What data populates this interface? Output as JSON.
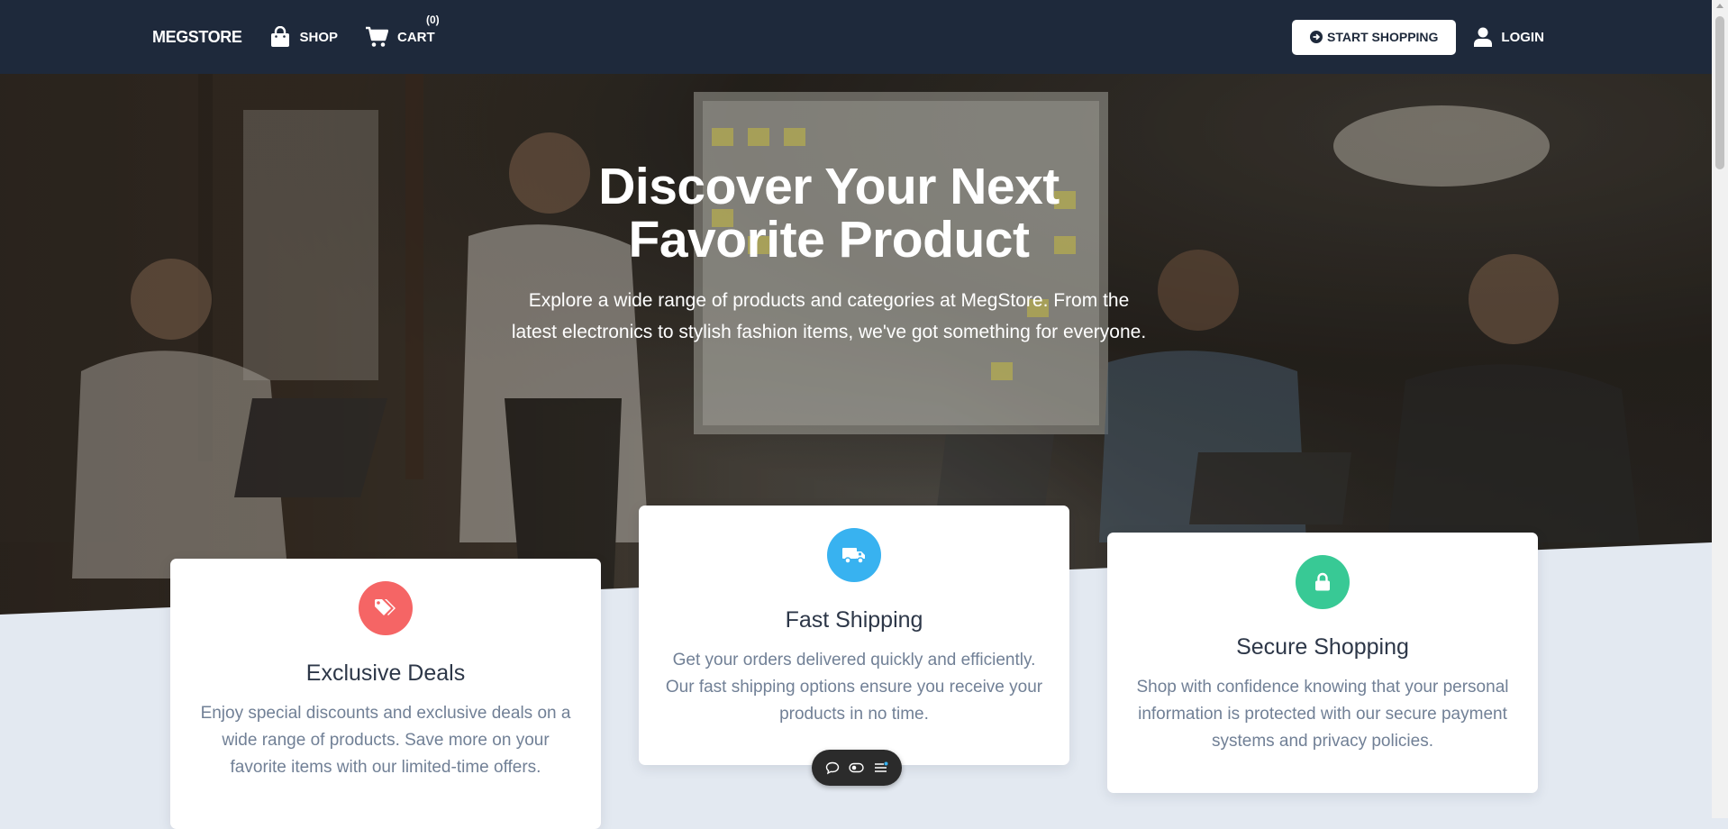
{
  "navbar": {
    "brand": "MEGSTORE",
    "shop_label": "SHOP",
    "cart_label": "CART",
    "cart_count": "(0)",
    "start_shopping_label": "START SHOPPING",
    "login_label": "LOGIN",
    "icons": {
      "shop": "shopping-bag-icon",
      "cart": "cart-icon",
      "start": "arrow-circle-right-icon",
      "login": "user-icon"
    }
  },
  "hero": {
    "title_line1": "Discover Your Next",
    "title_line2": "Favorite Product",
    "text": "Explore a wide range of products and categories at MegStore. From the latest electronics to stylish fashion items, we've got something for everyone."
  },
  "features": [
    {
      "title": "Exclusive Deals",
      "text": "Enjoy special discounts and exclusive deals on a wide range of products. Save more on your favorite items with our limited-time offers.",
      "icon": "tags-icon",
      "color": "#f56565"
    },
    {
      "title": "Fast Shipping",
      "text": "Get your orders delivered quickly and efficiently. Our fast shipping options ensure you receive your products in no time.",
      "icon": "truck-icon",
      "color": "#38b2f0"
    },
    {
      "title": "Secure Shopping",
      "text": "Shop with confidence knowing that your personal information is protected with our secure payment systems and privacy policies.",
      "icon": "lock-icon",
      "color": "#38c995"
    }
  ],
  "floating_toolbar": {
    "icons": [
      "chat-bubble-icon",
      "toggle-icon",
      "menu-list-icon"
    ]
  },
  "colors": {
    "navbar": "#1e293b",
    "page_bg": "#e3e9f1",
    "heading": "#2d3748",
    "body_text": "#718096"
  }
}
